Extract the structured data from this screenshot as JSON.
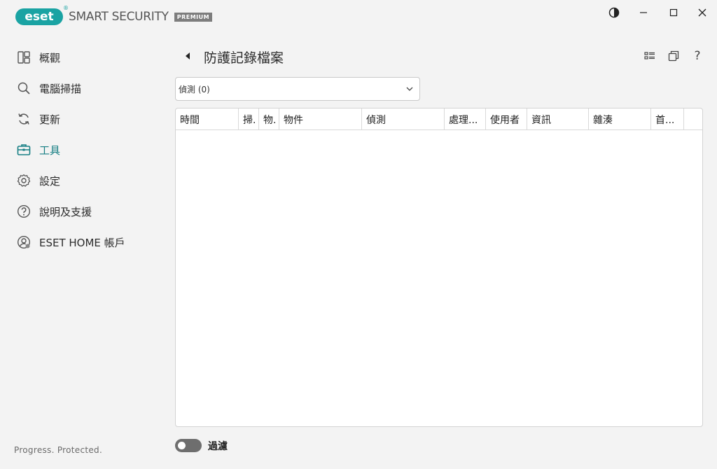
{
  "app": {
    "brand": "eset",
    "product": "SMART SECURITY",
    "edition": "PREMIUM"
  },
  "colors": {
    "accent": "#177f84",
    "brand": "#1aa3a3",
    "background": "#f3f3f3"
  },
  "window_controls": {
    "icons": [
      "contrast-icon",
      "minimize-icon",
      "maximize-icon",
      "close-icon"
    ]
  },
  "sidebar": {
    "items": [
      {
        "label": "概觀",
        "icon": "overview-icon",
        "active": false
      },
      {
        "label": "電腦掃描",
        "icon": "search-icon",
        "active": false
      },
      {
        "label": "更新",
        "icon": "refresh-icon",
        "active": false
      },
      {
        "label": "工具",
        "icon": "toolbox-icon",
        "active": true
      },
      {
        "label": "設定",
        "icon": "gear-icon",
        "active": false
      },
      {
        "label": "說明及支援",
        "icon": "help-circle-icon",
        "active": false
      },
      {
        "label": "ESET HOME 帳戶",
        "icon": "account-icon",
        "active": false
      }
    ],
    "footer": "Progress. Protected."
  },
  "header": {
    "title": "防護記錄檔案",
    "actions": [
      "list-view-icon",
      "copy-window-icon",
      "help-icon"
    ],
    "help_glyph": "?"
  },
  "log_type_select": {
    "value": "偵測 (0)"
  },
  "table": {
    "columns": [
      "時間",
      "掃.",
      "物.",
      "物件",
      "偵測",
      "處理...",
      "使用者",
      "資訊",
      "雜湊",
      "首..."
    ],
    "rows": []
  },
  "filter": {
    "label": "過濾",
    "enabled": false
  }
}
